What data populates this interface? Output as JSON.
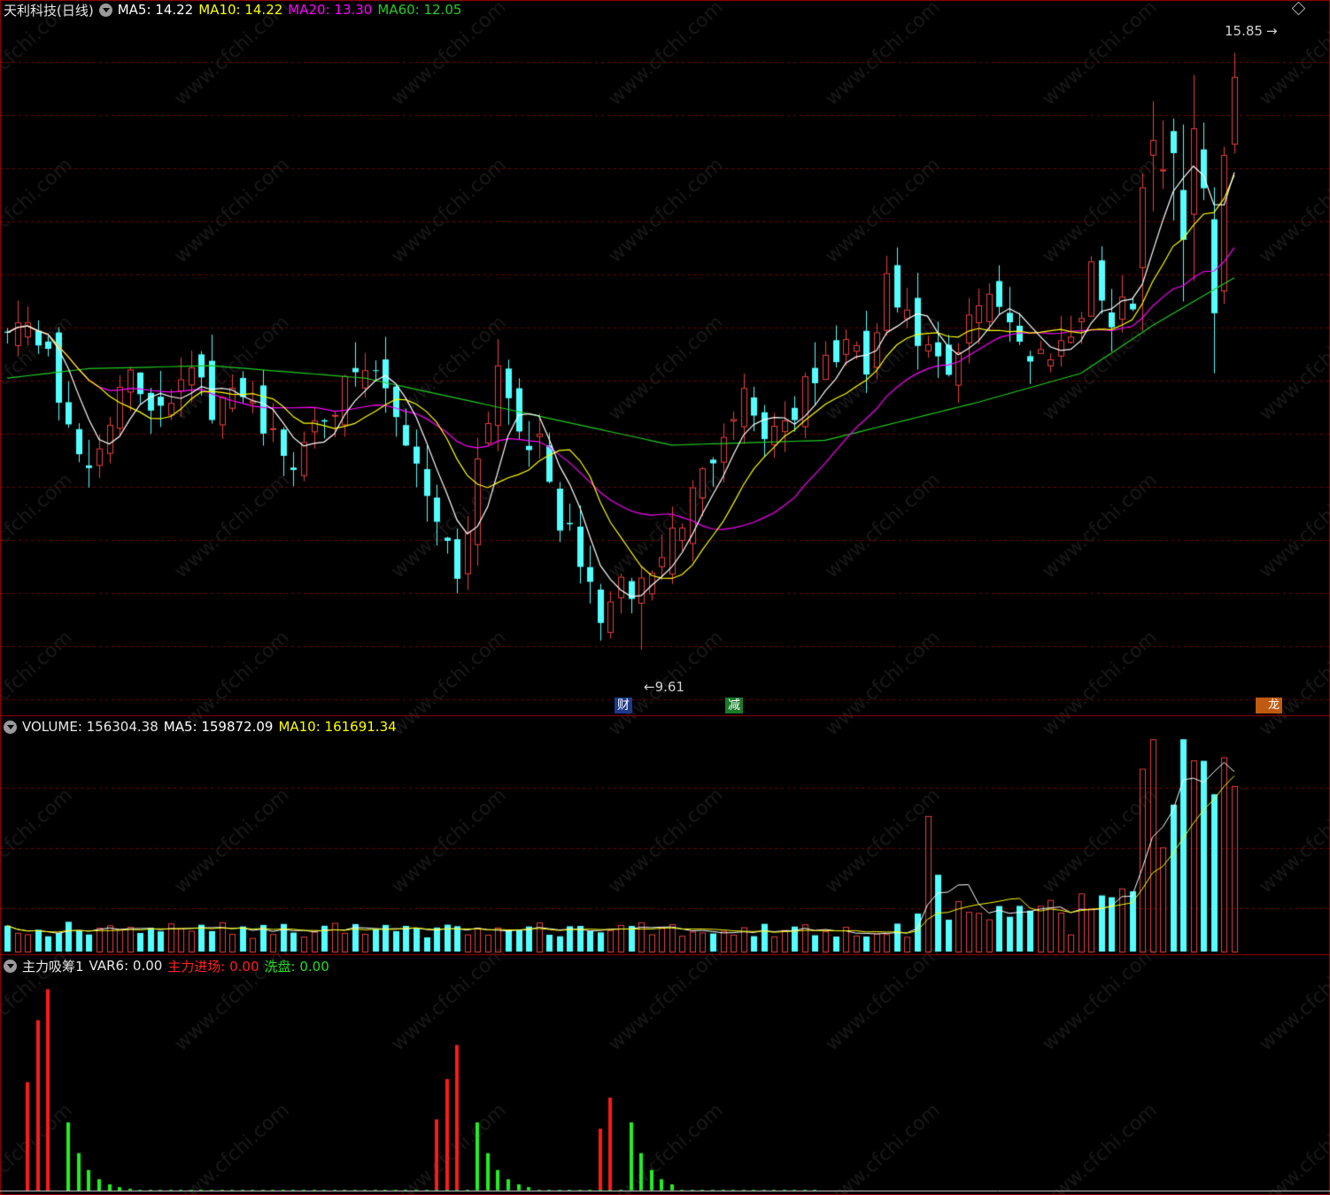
{
  "main": {
    "stock_label": "天利科技(日线)",
    "ma5_label": "MA5: 14.22",
    "ma10_label": "MA10: 14.22",
    "ma20_label": "MA20: 13.30",
    "ma60_label": "MA60: 12.05",
    "high_marker": "15.85",
    "low_marker": "9.61",
    "tag_cai": "财",
    "tag_jian": "减",
    "tag_bang": "龙虎榜"
  },
  "volume": {
    "label": "VOLUME: 156304.38",
    "ma5": "MA5: 159872.09",
    "ma10": "MA10: 161691.34"
  },
  "indicator": {
    "name": "主力吸筹1",
    "var6": "VAR6: 0.00",
    "enter": "主力进场: 0.00",
    "wash": "洗盘: 0.00"
  },
  "colors": {
    "up": "#e8403f",
    "down": "#54ffff",
    "ma5": "#ffffff",
    "ma10": "#ffff00",
    "ma20": "#ff00ff",
    "ma60": "#22cc22",
    "grid": "#7a0000",
    "watermark_text": "www.cfchi.com"
  },
  "chart_data": {
    "type": "candlestick",
    "price_range": [
      9.0,
      16.2
    ],
    "high": 15.85,
    "low": 9.61,
    "candle_keypoints": [
      [
        0,
        13.1
      ],
      [
        4,
        12.8
      ],
      [
        6,
        11.8
      ],
      [
        8,
        11.5
      ],
      [
        10,
        12.1
      ],
      [
        12,
        12.4
      ],
      [
        14,
        12.2
      ],
      [
        16,
        12.3
      ],
      [
        18,
        12.7
      ],
      [
        20,
        12.0
      ],
      [
        23,
        12.4
      ],
      [
        26,
        11.8
      ],
      [
        28,
        11.5
      ],
      [
        30,
        12.1
      ],
      [
        33,
        12.3
      ],
      [
        36,
        12.5
      ],
      [
        38,
        12.0
      ],
      [
        40,
        11.6
      ],
      [
        42,
        11.0
      ],
      [
        44,
        10.4
      ],
      [
        46,
        11.6
      ],
      [
        48,
        12.6
      ],
      [
        50,
        12.0
      ],
      [
        52,
        11.7
      ],
      [
        54,
        11.0
      ],
      [
        56,
        10.5
      ],
      [
        58,
        10.0
      ],
      [
        60,
        10.2
      ],
      [
        62,
        10.3
      ],
      [
        64,
        10.6
      ],
      [
        66,
        11.0
      ],
      [
        68,
        11.4
      ],
      [
        70,
        12.0
      ],
      [
        72,
        12.3
      ],
      [
        74,
        11.9
      ],
      [
        76,
        12.0
      ],
      [
        78,
        12.3
      ],
      [
        80,
        12.6
      ],
      [
        82,
        12.8
      ],
      [
        84,
        12.5
      ],
      [
        86,
        13.4
      ],
      [
        88,
        13.0
      ],
      [
        90,
        12.7
      ],
      [
        92,
        12.4
      ],
      [
        94,
        13.0
      ],
      [
        96,
        13.4
      ],
      [
        98,
        13.1
      ],
      [
        100,
        12.6
      ],
      [
        102,
        12.8
      ],
      [
        104,
        12.9
      ],
      [
        106,
        13.6
      ],
      [
        108,
        13.0
      ],
      [
        110,
        13.3
      ],
      [
        111,
        14.5
      ],
      [
        112,
        15.1
      ],
      [
        113,
        14.7
      ],
      [
        114,
        15.0
      ],
      [
        115,
        14.0
      ],
      [
        116,
        14.9
      ],
      [
        117,
        14.1
      ],
      [
        118,
        13.5
      ],
      [
        119,
        14.8
      ],
      [
        120,
        15.6
      ]
    ],
    "ma60_keypoints": [
      [
        0,
        12.45
      ],
      [
        8,
        12.55
      ],
      [
        20,
        12.58
      ],
      [
        35,
        12.45
      ],
      [
        50,
        12.1
      ],
      [
        65,
        11.75
      ],
      [
        80,
        11.8
      ],
      [
        95,
        12.2
      ],
      [
        105,
        12.5
      ],
      [
        112,
        13.0
      ],
      [
        120,
        13.5
      ]
    ],
    "volume_total_days": 121,
    "mainforce_bars": [
      {
        "day": 2,
        "values": [
          3.5,
          5.5,
          6.5
        ]
      },
      {
        "day": 42,
        "values": [
          2.3,
          3.6,
          4.7
        ]
      },
      {
        "day": 58,
        "values": [
          2.0,
          3.0
        ]
      }
    ],
    "washout_tail_days": [
      6,
      7,
      8,
      9,
      10,
      11,
      12,
      46,
      47,
      48,
      49,
      50,
      51,
      61,
      62,
      63,
      64,
      65
    ]
  }
}
